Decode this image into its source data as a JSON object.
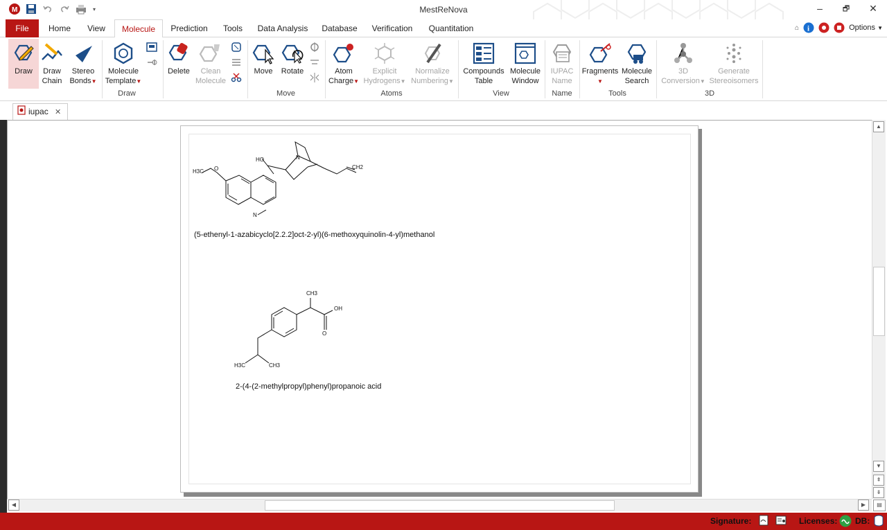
{
  "app": {
    "title": "MestReNova"
  },
  "window": {
    "minimize": "–",
    "restore": "🗗",
    "close": "✕"
  },
  "ribbon_tabs": [
    "File",
    "Home",
    "View",
    "Molecule",
    "Prediction",
    "Tools",
    "Data Analysis",
    "Database",
    "Verification",
    "Quantitation"
  ],
  "active_tab": "Molecule",
  "options_label": "Options",
  "ribbon": {
    "draw": {
      "label": "Draw"
    },
    "draw_chain": {
      "label1": "Draw",
      "label2": "Chain"
    },
    "stereo_bonds": {
      "label1": "Stereo",
      "label2": "Bonds"
    },
    "molecule_template": {
      "label1": "Molecule",
      "label2": "Template"
    },
    "delete": {
      "label": "Delete"
    },
    "clean_molecule": {
      "label1": "Clean",
      "label2": "Molecule"
    },
    "move": {
      "label": "Move"
    },
    "rotate": {
      "label": "Rotate"
    },
    "atom_charge": {
      "label1": "Atom",
      "label2": "Charge"
    },
    "explicit_hydrogens": {
      "label1": "Explicit",
      "label2": "Hydrogens"
    },
    "normalize_numbering": {
      "label1": "Normalize",
      "label2": "Numbering"
    },
    "compounds_table": {
      "label1": "Compounds",
      "label2": "Table"
    },
    "molecule_window": {
      "label1": "Molecule",
      "label2": "Window"
    },
    "iupac_name": {
      "label1": "IUPAC",
      "label2": "Name"
    },
    "fragments": {
      "label": "Fragments"
    },
    "molecule_search": {
      "label1": "Molecule",
      "label2": "Search"
    },
    "conversion_3d": {
      "label1": "3D",
      "label2": "Conversion"
    },
    "generate_stereoisomers": {
      "label1": "Generate",
      "label2": "Stereoisomers"
    },
    "groups": {
      "draw": "Draw",
      "move": "Move",
      "atoms": "Atoms",
      "view": "View",
      "name": "Name",
      "tools": "Tools",
      "d3": "3D"
    }
  },
  "document_tab": {
    "label": "iupac",
    "close": "✕"
  },
  "molecules": [
    {
      "name": "(5-ethenyl-1-azabicyclo[2.2.2]oct-2-yl)(6-methoxyquinolin-4-yl)methanol"
    },
    {
      "name": "2-(4-(2-methylpropyl)phenyl)propanoic acid"
    }
  ],
  "atom_labels": {
    "m1": {
      "h3c": "H3C",
      "o": "O",
      "ho": "HO",
      "n1": "N",
      "ch2": "CH2",
      "n_ring": "N"
    },
    "m2": {
      "ch3_top": "CH3",
      "oh": "OH",
      "o": "O",
      "h3c": "H3C",
      "ch3_right": "CH3"
    }
  },
  "status": {
    "signature": "Signature:",
    "licenses": "Licenses:",
    "db": "DB:"
  },
  "colors": {
    "accent": "#b81614",
    "ribbon_icon_blue": "#1d4e89",
    "disabled": "#a5a5a5"
  }
}
